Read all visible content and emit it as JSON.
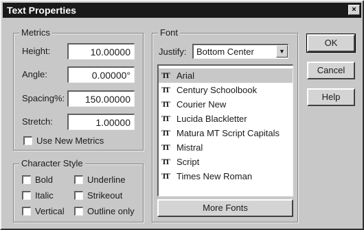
{
  "window": {
    "title": "Text Properties",
    "close_glyph": "×"
  },
  "metrics": {
    "label": "Metrics",
    "height_label": "Height:",
    "height_value": "10.00000",
    "angle_label": "Angle:",
    "angle_value": "0.00000°",
    "spacing_label": "Spacing%:",
    "spacing_value": "150.00000",
    "stretch_label": "Stretch:",
    "stretch_value": "1.00000",
    "use_new_metrics_label": "Use New Metrics"
  },
  "character_style": {
    "label": "Character Style",
    "bold": "Bold",
    "underline": "Underline",
    "italic": "Italic",
    "strikeout": "Strikeout",
    "vertical": "Vertical",
    "outline_only": "Outline only"
  },
  "font": {
    "label": "Font",
    "justify_label": "Justify:",
    "justify_value": "Bottom Center",
    "list": [
      "Arial",
      "Century Schoolbook",
      "Courier New",
      "Lucida Blackletter",
      "Matura MT Script Capitals",
      "Mistral",
      "Script",
      "Times New Roman"
    ],
    "selected": "Arial",
    "item_icon": "truetype-icon",
    "more_fonts_label": "More Fonts"
  },
  "buttons": {
    "ok": "OK",
    "cancel": "Cancel",
    "help": "Help"
  }
}
